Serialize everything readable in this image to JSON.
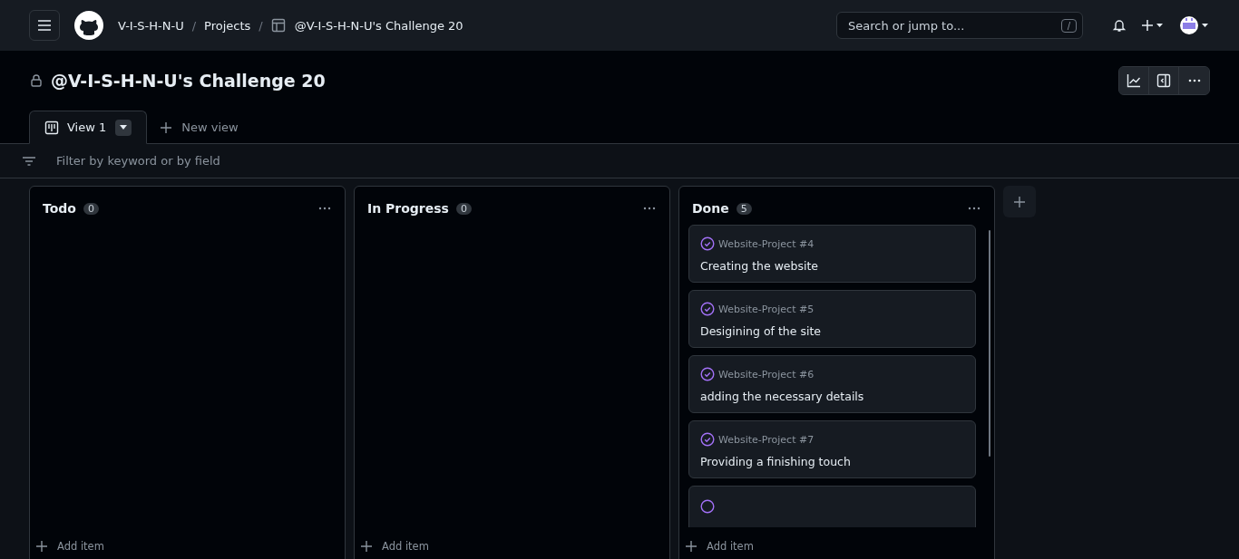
{
  "header": {
    "breadcrumbs": [
      "V-I-S-H-N-U",
      "Projects",
      "@V-I-S-H-N-U's Challenge 20"
    ],
    "separators": [
      "/",
      "/"
    ],
    "search": {
      "placeholder": "Search or jump to...",
      "shortcut": "/"
    }
  },
  "project": {
    "title": "@V-I-S-H-N-U's Challenge 20",
    "private": true
  },
  "views": [
    {
      "label": "View 1",
      "selected": true
    },
    {
      "label": "New view",
      "kind": "add"
    }
  ],
  "filter": {
    "placeholder": "Filter by keyword or by field"
  },
  "columns": [
    {
      "name": "Todo",
      "count": "0",
      "add_label": "Add item",
      "more_below": false
    },
    {
      "name": "In Progress",
      "count": "0",
      "add_label": "Add item",
      "more_below": false
    },
    {
      "name": "Done",
      "count": "5",
      "items": [
        {
          "repo": "Website-Project #4",
          "title": "Creating the website",
          "kind": "closed"
        },
        {
          "repo": "Website-Project #5",
          "title": "Desigining of the site",
          "kind": "closed"
        },
        {
          "repo": "Website-Project #6",
          "title": "adding the necessary details",
          "kind": "closed"
        },
        {
          "repo": "Website-Project #7",
          "title": "Providing a finishing touch",
          "kind": "closed"
        }
      ],
      "add_label": "Add item",
      "more_below": true
    }
  ]
}
